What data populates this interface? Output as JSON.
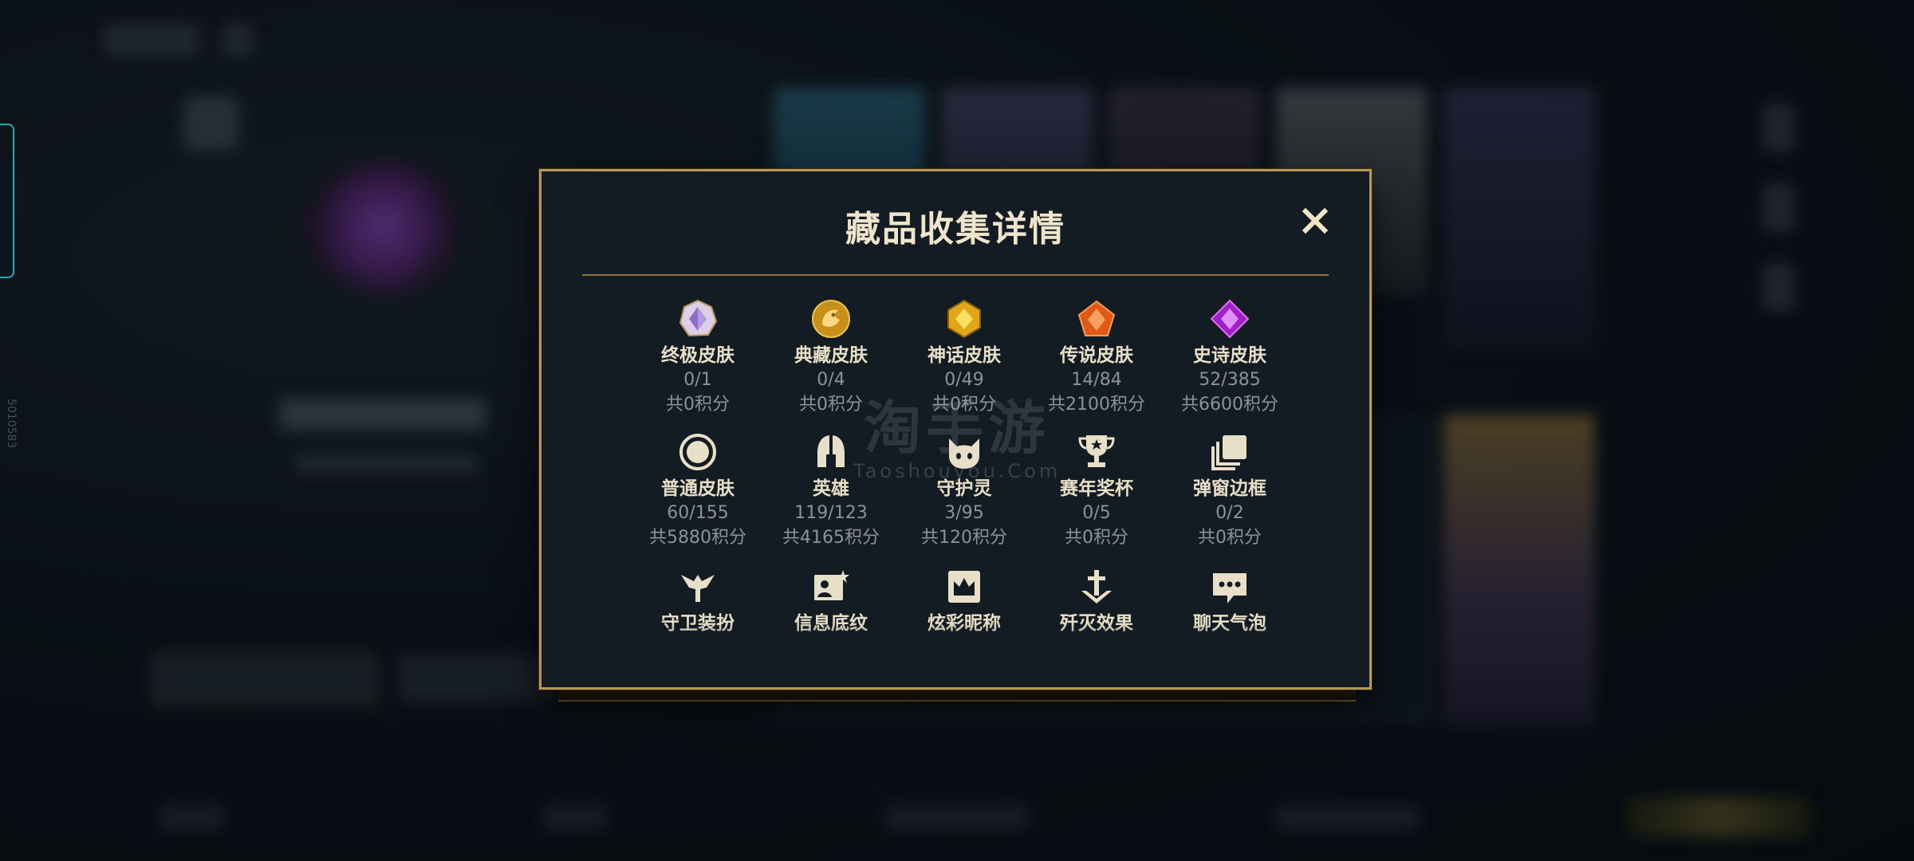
{
  "side_id": "5010583",
  "modal": {
    "title": "藏品收集详情",
    "items": [
      {
        "label": "终极皮肤",
        "count": "0/1",
        "points": "共0积分",
        "icon": "ultimate-skin-icon"
      },
      {
        "label": "典藏皮肤",
        "count": "0/4",
        "points": "共0积分",
        "icon": "collection-skin-icon"
      },
      {
        "label": "神话皮肤",
        "count": "0/49",
        "points": "共0积分",
        "icon": "mythic-skin-icon"
      },
      {
        "label": "传说皮肤",
        "count": "14/84",
        "points": "共2100积分",
        "icon": "legendary-skin-icon"
      },
      {
        "label": "史诗皮肤",
        "count": "52/385",
        "points": "共6600积分",
        "icon": "epic-skin-icon"
      },
      {
        "label": "普通皮肤",
        "count": "60/155",
        "points": "共5880积分",
        "icon": "normal-skin-icon"
      },
      {
        "label": "英雄",
        "count": "119/123",
        "points": "共4165积分",
        "icon": "hero-helmet-icon"
      },
      {
        "label": "守护灵",
        "count": "3/95",
        "points": "共120积分",
        "icon": "guardian-spirit-icon"
      },
      {
        "label": "赛年奖杯",
        "count": "0/5",
        "points": "共0积分",
        "icon": "trophy-icon"
      },
      {
        "label": "弹窗边框",
        "count": "0/2",
        "points": "共0积分",
        "icon": "popup-frame-icon"
      },
      {
        "label": "守卫装扮",
        "icon": "ward-skin-icon"
      },
      {
        "label": "信息底纹",
        "icon": "info-card-icon"
      },
      {
        "label": "炫彩昵称",
        "icon": "colorful-name-icon"
      },
      {
        "label": "歼灭效果",
        "icon": "elimination-effect-icon"
      },
      {
        "label": "聊天气泡",
        "icon": "chat-bubble-icon"
      }
    ]
  },
  "watermark": {
    "line1": "淘手游",
    "line2": "Taoshouyou.Com"
  },
  "colors": {
    "gold_border": "#b89758",
    "panel": "#141c23",
    "label": "#e8dfc8",
    "muted": "#8c9298"
  }
}
